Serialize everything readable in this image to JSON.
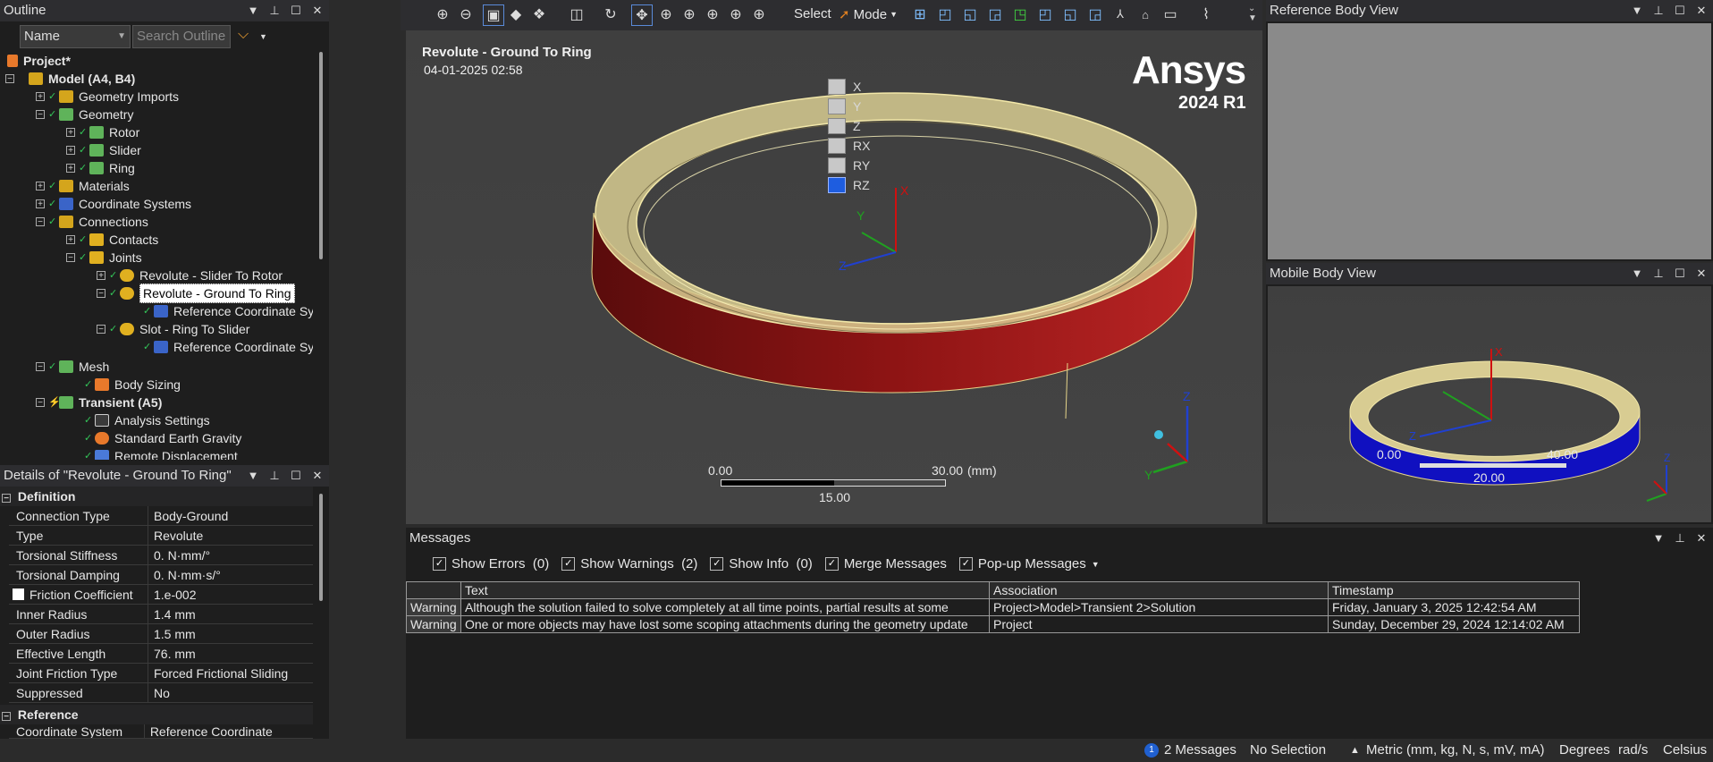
{
  "outline": {
    "title": "Outline",
    "name_combo": "Name",
    "search_placeholder": "Search Outline",
    "tree": [
      {
        "label": "Project*",
        "bold": true
      },
      {
        "label": "Model (A4, B4)",
        "bold": true
      },
      {
        "label": "Geometry Imports"
      },
      {
        "label": "Geometry"
      },
      {
        "label": "Rotor"
      },
      {
        "label": "Slider"
      },
      {
        "label": "Ring"
      },
      {
        "label": "Materials"
      },
      {
        "label": "Coordinate Systems"
      },
      {
        "label": "Connections"
      },
      {
        "label": "Contacts"
      },
      {
        "label": "Joints"
      },
      {
        "label": "Revolute - Slider To Rotor"
      },
      {
        "label": "Revolute - Ground To Ring",
        "selected": true
      },
      {
        "label": "Reference Coordinate System"
      },
      {
        "label": "Slot - Ring To Slider"
      },
      {
        "label": "Reference Coordinate System"
      },
      {
        "label": "Mesh"
      },
      {
        "label": "Body Sizing"
      },
      {
        "label": "Transient (A5)",
        "bold": true
      },
      {
        "label": "Analysis Settings"
      },
      {
        "label": "Standard Earth Gravity"
      },
      {
        "label": "Remote Displacement"
      }
    ]
  },
  "details": {
    "title": "Details of \"Revolute - Ground To Ring\"",
    "section_definition": "Definition",
    "rows": [
      {
        "key": "Connection Type",
        "value": "Body-Ground"
      },
      {
        "key": "Type",
        "value": "Revolute"
      },
      {
        "key": "Torsional Stiffness",
        "value": "0. N·mm/°"
      },
      {
        "key": "Torsional Damping",
        "value": "0. N·mm·s/°"
      },
      {
        "key": "Friction Coefficient",
        "value": "1.e-002"
      },
      {
        "key": "Inner Radius",
        "value": "1.4 mm"
      },
      {
        "key": "Outer Radius",
        "value": "1.5 mm"
      },
      {
        "key": "Effective Length",
        "value": "76. mm"
      },
      {
        "key": "Joint Friction Type",
        "value": "Forced Frictional Sliding"
      },
      {
        "key": "Suppressed",
        "value": "No"
      }
    ],
    "section_reference": "Reference",
    "partial_row": {
      "key": "Coordinate System",
      "value": "Reference Coordinate System"
    }
  },
  "toolbar": {
    "select_label": "Select",
    "mode_label": "Mode"
  },
  "viewport": {
    "title": "Revolute - Ground To Ring",
    "date": "04-01-2025 02:58",
    "logo": "Ansys",
    "version": "2024 R1",
    "dof": [
      "X",
      "Y",
      "Z",
      "RX",
      "RY",
      "RZ"
    ],
    "dof_checked": [
      false,
      false,
      false,
      false,
      false,
      true
    ],
    "scale": {
      "start": "0.00",
      "end": "30.00",
      "unit": "(mm)",
      "mid": "15.00"
    }
  },
  "reference_view": {
    "title": "Reference Body View"
  },
  "mobile_view": {
    "title": "Mobile Body View",
    "scale": {
      "start": "0.00",
      "end": "40.00",
      "mid": "20.00"
    }
  },
  "messages": {
    "title": "Messages",
    "show_errors": "Show Errors",
    "errors_count": "(0)",
    "show_warnings": "Show Warnings",
    "warnings_count": "(2)",
    "show_info": "Show Info",
    "info_count": "(0)",
    "merge": "Merge Messages",
    "popup": "Pop-up Messages",
    "columns": [
      "Text",
      "Association",
      "Timestamp"
    ],
    "rows": [
      {
        "type": "Warning",
        "text": "Although the solution failed to solve completely at all time points, partial results at some",
        "assoc": "Project>Model>Transient 2>Solution",
        "time": "Friday, January 3, 2025 12:42:54 AM"
      },
      {
        "type": "Warning",
        "text": "One or more objects may have lost some scoping attachments during the geometry update",
        "assoc": "Project",
        "time": "Sunday, December 29, 2024 12:14:02 AM"
      }
    ]
  },
  "status": {
    "message_count": "1",
    "messages": "2 Messages",
    "selection": "No Selection",
    "units": "Metric (mm, kg, N, s, mV, mA)",
    "angle": "Degrees",
    "rate": "rad/s",
    "temp": "Celsius"
  }
}
